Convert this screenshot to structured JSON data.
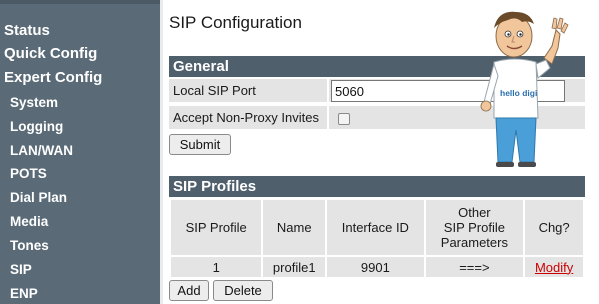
{
  "sidebar": {
    "main_items": [
      {
        "label": "Status"
      },
      {
        "label": "Quick Config"
      },
      {
        "label": "Expert Config"
      }
    ],
    "sub_items": [
      {
        "label": "System"
      },
      {
        "label": "Logging"
      },
      {
        "label": "LAN/WAN"
      },
      {
        "label": "POTS"
      },
      {
        "label": "Dial Plan"
      },
      {
        "label": "Media"
      },
      {
        "label": "Tones"
      },
      {
        "label": "SIP"
      },
      {
        "label": "ENP"
      }
    ]
  },
  "page": {
    "title": "SIP Configuration"
  },
  "general": {
    "heading": "General",
    "local_sip_port_label": "Local SIP Port",
    "local_sip_port_value": "5060",
    "non_proxy_label": "Accept Non-Proxy Invites",
    "non_proxy_checked": false,
    "submit_label": "Submit"
  },
  "profiles": {
    "heading": "SIP Profiles",
    "columns": {
      "sip_profile": "SIP Profile",
      "name": "Name",
      "interface_id": "Interface ID",
      "other_line1": "Other",
      "other_line2": "SIP Profile",
      "other_line3": "Parameters",
      "chg": "Chg?"
    },
    "rows": [
      {
        "sip_profile": "1",
        "name": "profile1",
        "interface_id": "9901",
        "other": "===>",
        "chg": "Modify"
      }
    ],
    "add_label": "Add",
    "delete_label": "Delete"
  },
  "mascot": {
    "shirt_text": "hello digi",
    "colors": {
      "shirt": "#ffffff",
      "pants": "#4a9fd8",
      "hair": "#6b4a2a",
      "skin": "#f2c69b"
    }
  }
}
